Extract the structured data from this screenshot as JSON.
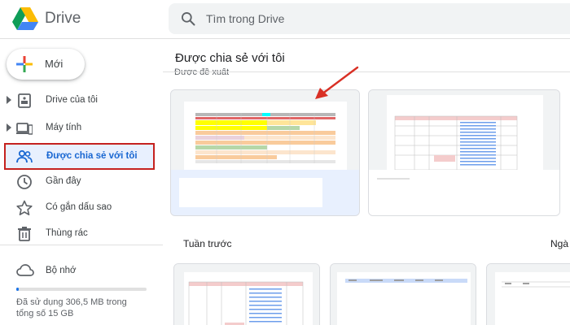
{
  "app": {
    "title": "Drive"
  },
  "search": {
    "placeholder": "Tìm trong Drive"
  },
  "sidebar": {
    "new_label": "Mới",
    "items": [
      {
        "label": "Drive của tôi",
        "icon": "my-drive-icon",
        "expandable": true
      },
      {
        "label": "Máy tính",
        "icon": "computer-icon",
        "expandable": true
      },
      {
        "label": "Được chia sẻ với tôi",
        "icon": "shared-with-me-icon",
        "active": true
      },
      {
        "label": "Gần đây",
        "icon": "clock-icon"
      },
      {
        "label": "Có gắn dấu sao",
        "icon": "star-icon"
      },
      {
        "label": "Thùng rác",
        "icon": "trash-icon"
      }
    ],
    "storage": {
      "label": "Bộ nhớ",
      "usage_text": "Đã sử dụng 306,5 MB trong tổng số 15 GB",
      "used_fraction": 0.02
    }
  },
  "main": {
    "title": "Được chia sẻ với tôi",
    "suggested_label": "Được đề xuất",
    "section_previous_week": "Tuần trước",
    "section_right_partial": "Ngà"
  },
  "colors": {
    "accent": "#1a73e8",
    "active_bg": "#e8f0fe",
    "active_text": "#1967d2",
    "highlight_border": "#c5221f",
    "annotation_arrow": "#d93025"
  }
}
